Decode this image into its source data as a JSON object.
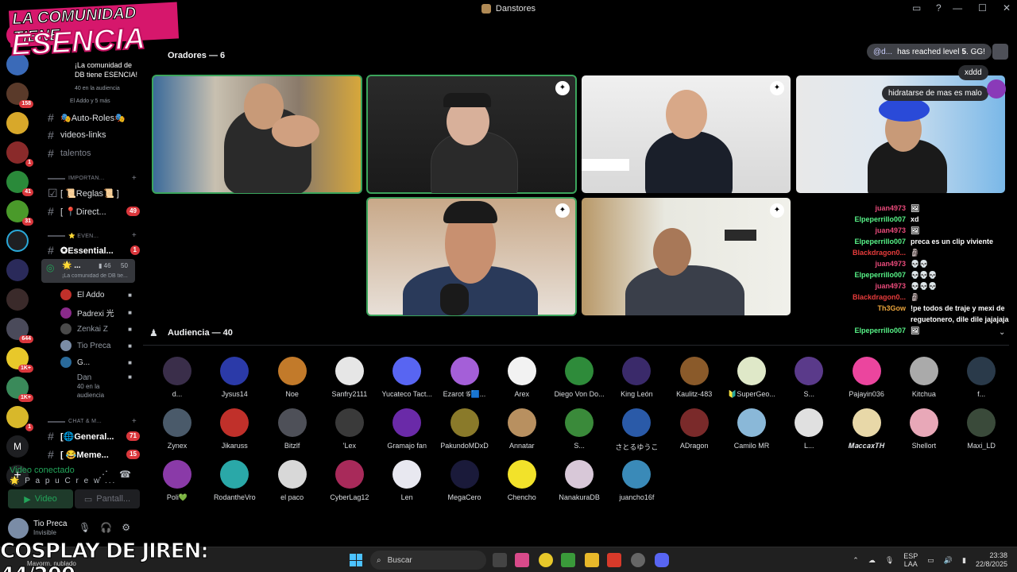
{
  "window": {
    "title": "Danstores"
  },
  "stage": {
    "speakers_title": "Oradores — 6",
    "audience_title": "Audiencia — 40"
  },
  "sidebar": {
    "stage_name": "¡La comunidad de DB tiene ESENCIA!",
    "stage_listeners": "40 en la audiencia",
    "stage_members": "El Addo y 5 más",
    "channels": [
      {
        "label": "🎭Auto-Roles🎭"
      },
      {
        "label": "videos-links"
      },
      {
        "label": "talentos"
      }
    ],
    "cat_important": "IMPORTAN...",
    "ch_reglas": "[ 📜Reglas📜 ]",
    "ch_direct": "[ 📍Direct...",
    "ch_direct_badge": "49",
    "cat_events": "⭐ EVEN...",
    "ch_essential": "✪Essential...",
    "ch_essential_badge": "1",
    "vc_name": "🌟 ...",
    "vc_count_a": "46",
    "vc_count_b": "50",
    "vc_sub": "¡La comunidad de DB tie...",
    "vc_users": [
      "El Addo",
      "Padrexi 光",
      "Zenkai Z",
      "Tio Preca",
      "G..."
    ],
    "vc_extra_user": "Dan",
    "vc_extra_sub": "40 en la audiencia",
    "cat_chat": "CHAT & M...",
    "ch_general": "[🌐General...",
    "ch_general_badge": "71",
    "ch_meme": "[ 😂Meme...",
    "ch_meme_badge": "15"
  },
  "rail_badges": [
    "158",
    "1",
    "41",
    "31",
    "644",
    "1K+",
    "1K+",
    "1"
  ],
  "rail_letter": "M",
  "voice": {
    "status": "Video conectado",
    "channel": "🌟 P a p u C r e w ...",
    "video_btn": "Video",
    "screen_btn": "Pantall..."
  },
  "user": {
    "name": "Tio Preca",
    "status": "Invisible"
  },
  "notification": {
    "mention": "@d...",
    "text": "has reached level",
    "level": "5",
    "suffix": ". GG!"
  },
  "bubbles": [
    "xddd",
    "hidratarse de mas es malo"
  ],
  "chat": [
    {
      "who": "juan4973",
      "msg": "🖼",
      "color": "#e84a7a"
    },
    {
      "who": "Elpeperrillo007",
      "msg": "xd",
      "color": "#57f287"
    },
    {
      "who": "juan4973",
      "msg": "🖼",
      "color": "#e84a7a"
    },
    {
      "who": "Elpeperrillo007",
      "msg": "preca es un clip viviente",
      "color": "#57f287"
    },
    {
      "who": "Blackdragon0...",
      "msg": "🗿",
      "color": "#e83c3c"
    },
    {
      "who": "juan4973",
      "msg": "💀💀",
      "color": "#e84a7a"
    },
    {
      "who": "Elpeperrillo007",
      "msg": "💀💀💀",
      "color": "#57f287"
    },
    {
      "who": "juan4973",
      "msg": "💀💀💀",
      "color": "#e84a7a"
    },
    {
      "who": "Blackdragon0...",
      "msg": "🗿",
      "color": "#e83c3c"
    },
    {
      "who": "Th3Gow",
      "msg": "!pe todos de traje y mexi de reguetonero, dile dile jajajaja",
      "color": "#e8a33c"
    },
    {
      "who": "Elpeperrillo007",
      "msg": "🖼",
      "color": "#57f287"
    }
  ],
  "audience": [
    {
      "name": "d...",
      "color": "#3a2e4a"
    },
    {
      "name": "Jysus14",
      "color": "#2b3aa8"
    },
    {
      "name": "Noe",
      "color": "#c27a2a"
    },
    {
      "name": "Sanfry2111",
      "color": "#e6e6e6"
    },
    {
      "name": "Yucateco Tact...",
      "color": "#5865f2"
    },
    {
      "name": "Ezarot 𝒢🟦...",
      "color": "#a45fd8"
    },
    {
      "name": "Arex",
      "color": "#f2f2f2"
    },
    {
      "name": "Diego Von Do...",
      "color": "#2e8b3a"
    },
    {
      "name": "King León",
      "color": "#3a2a6a"
    },
    {
      "name": "Kaulitz-483",
      "color": "#8a5a2a"
    },
    {
      "name": "🔰SuperGeo...",
      "color": "#dfe8c8"
    },
    {
      "name": "S...",
      "color": "#5a3a8a"
    },
    {
      "name": "Pajayin036",
      "color": "#eb459e"
    },
    {
      "name": "Kitchua",
      "color": "#aaaaaa"
    },
    {
      "name": "f...",
      "color": "#2a3a4a"
    },
    {
      "name": "Zynex",
      "color": "#4a5a6a"
    },
    {
      "name": "Jikaruss",
      "color": "#c0302a"
    },
    {
      "name": "Bitzlf",
      "color": "#4e5058"
    },
    {
      "name": "'Lex",
      "color": "#3a3a3a"
    },
    {
      "name": "Gramajo fan",
      "color": "#6a2aa8"
    },
    {
      "name": "PakundoMDxD",
      "color": "#8a7a2a"
    },
    {
      "name": "Annatar",
      "color": "#b89060"
    },
    {
      "name": "S...",
      "color": "#3a8a3a"
    },
    {
      "name": "さとるゆうこ",
      "color": "#2a5aa8"
    },
    {
      "name": "ADragon",
      "color": "#7a2a2a"
    },
    {
      "name": "Camilo MR",
      "color": "#8ab8d8"
    },
    {
      "name": "L...",
      "color": "#e0e0e0"
    },
    {
      "name": "𝑴𝒂𝒄𝒄𝒂𝒙𝑻𝑯",
      "color": "#e8d8a8"
    },
    {
      "name": "Shellort",
      "color": "#e8a8b8"
    },
    {
      "name": "Maxi_LD",
      "color": "#3a4a3a"
    },
    {
      "name": "Poli💚",
      "color": "#8a3aa8"
    },
    {
      "name": "RodantheVro",
      "color": "#2aa8a8"
    },
    {
      "name": "el paco",
      "color": "#d8d8d8"
    },
    {
      "name": "CyberLag12",
      "color": "#a82a5a"
    },
    {
      "name": "Len",
      "color": "#e8e8f0"
    },
    {
      "name": "MegaCero",
      "color": "#1a1a3a"
    },
    {
      "name": "Chencho",
      "color": "#f2e22a"
    },
    {
      "name": "NanakuraDB",
      "color": "#d8c8d8"
    },
    {
      "name": "juancho16f",
      "color": "#3a8ab8"
    }
  ],
  "overlay": {
    "logo_line1": "LA COMUNIDAD TIENE",
    "logo_line2": "ESENCIA",
    "counter": "COSPLAY DE JIREN: 44/200"
  },
  "taskbar": {
    "weather": "Mayorm. nublado",
    "search": "Buscar",
    "lang": "ESP",
    "lang2": "LAA",
    "time": "23:38",
    "date": "22/8/2025"
  }
}
